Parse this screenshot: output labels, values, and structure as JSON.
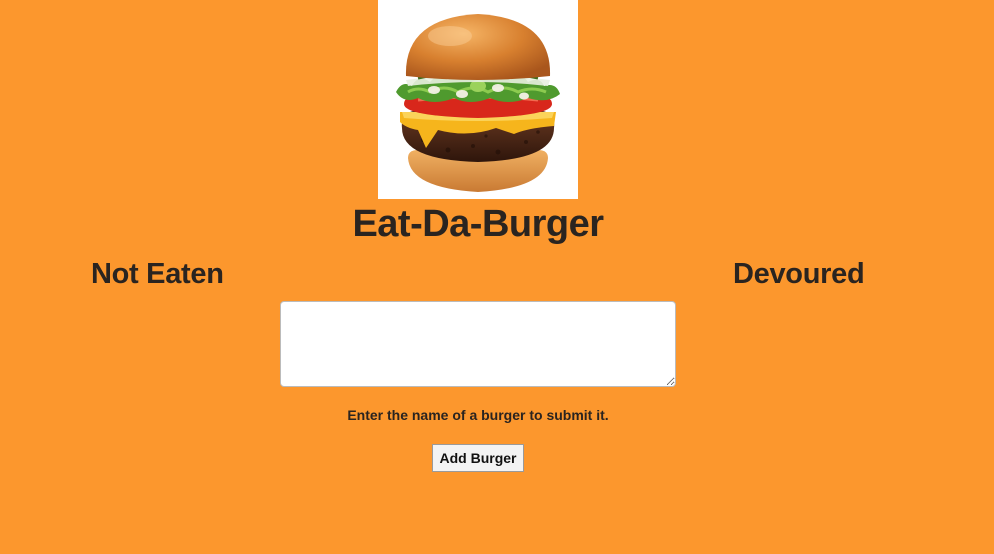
{
  "header": {
    "image_alt": "burger-image",
    "title": "Eat-Da-Burger"
  },
  "columns": {
    "left_heading": "Not Eaten",
    "right_heading": "Devoured"
  },
  "form": {
    "input_value": "",
    "hint": "Enter the name of a burger to submit it.",
    "submit_label": "Add Burger"
  },
  "colors": {
    "page_background": "#FC972D",
    "text": "#2a2420",
    "input_background": "#ffffff"
  }
}
